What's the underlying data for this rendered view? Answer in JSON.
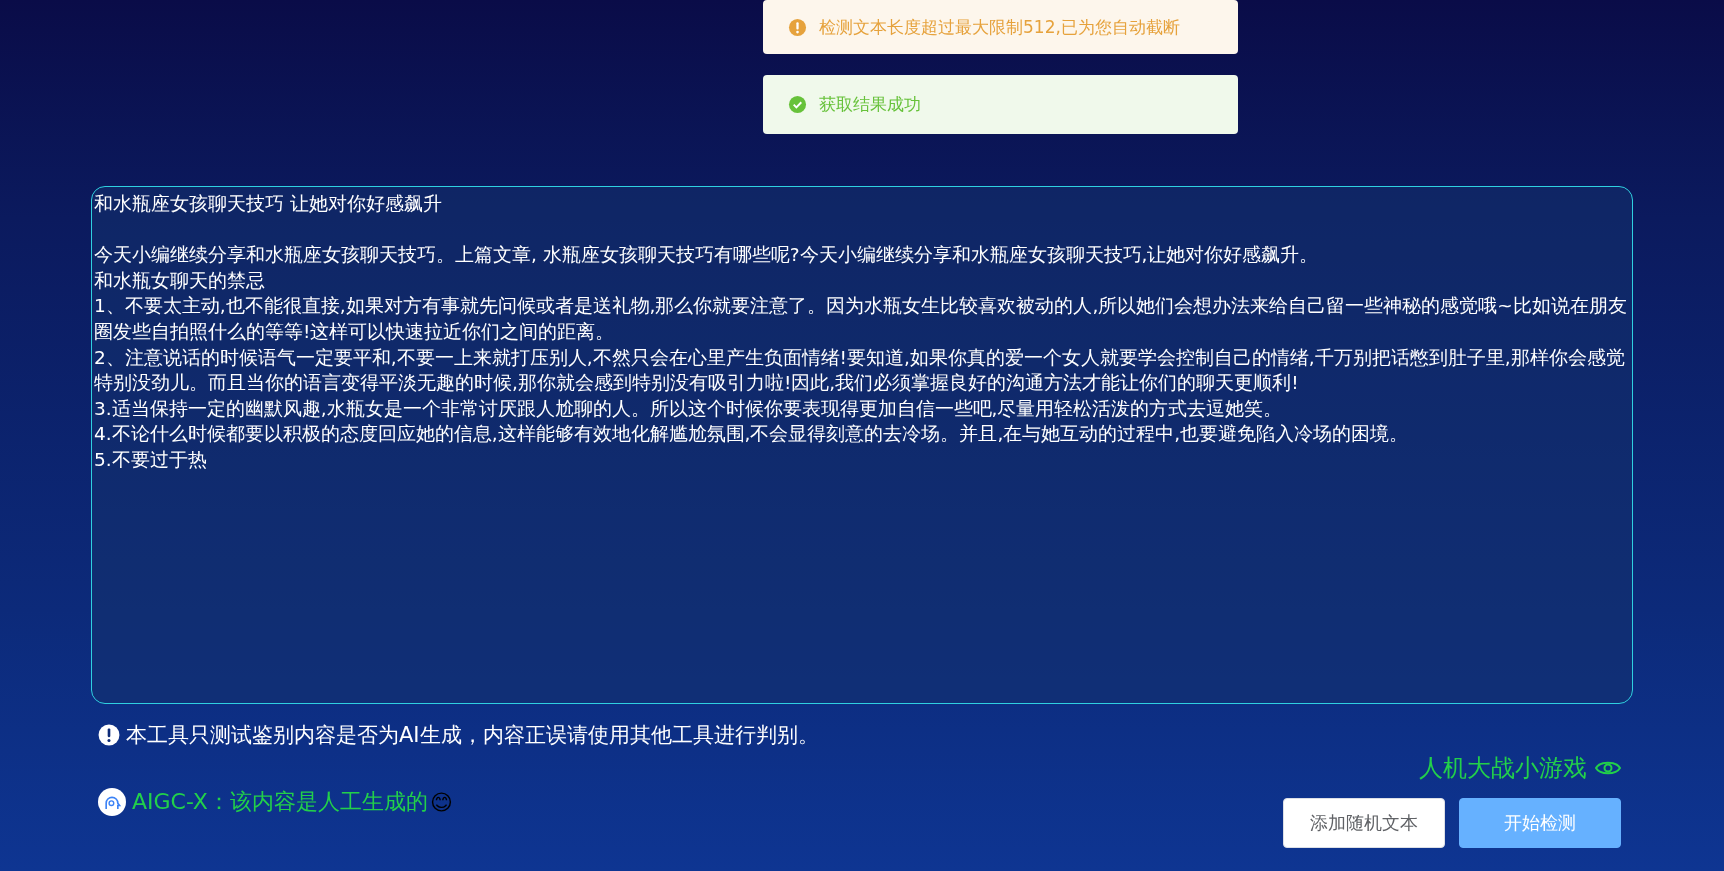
{
  "toasts": [
    {
      "kind": "warning",
      "message": "检测文本长度超过最大限制512,已为您自动截断"
    },
    {
      "kind": "success",
      "message": "获取结果成功"
    }
  ],
  "input": {
    "title": "和水瓶座女孩聊天技巧 让她对你好感飙升",
    "lines": [
      "今天小编继续分享和水瓶座女孩聊天技巧。上篇文章, 水瓶座女孩聊天技巧有哪些呢?今天小编继续分享和水瓶座女孩聊天技巧,让她对你好感飙升。",
      "和水瓶女聊天的禁忌",
      "1、不要太主动,也不能很直接,如果对方有事就先问候或者是送礼物,那么你就要注意了。因为水瓶女生比较喜欢被动的人,所以她们会想办法来给自己留一些神秘的感觉哦~比如说在朋友圈发些自拍照什么的等等!这样可以快速拉近你们之间的距离。",
      "2、注意说话的时候语气一定要平和,不要一上来就打压别人,不然只会在心里产生负面情绪!要知道,如果你真的爱一个女人就要学会控制自己的情绪,千万别把话憋到肚子里,那样你会感觉特别没劲儿。而且当你的语言变得平淡无趣的时候,那你就会感到特别没有吸引力啦!因此,我们必须掌握良好的沟通方法才能让你们的聊天更顺利!",
      "3.适当保持一定的幽默风趣,水瓶女是一个非常讨厌跟人尬聊的人。所以这个时候你要表现得更加自信一些吧,尽量用轻松活泼的方式去逗她笑。",
      "4.不论什么时候都要以积极的态度回应她的信息,这样能够有效地化解尴尬氛围,不会显得刻意的去冷场。并且,在与她互动的过程中,也要避免陷入冷场的困境。",
      "5.不要过于热"
    ]
  },
  "notice": "本工具只测试鉴别内容是否为AI生成，内容正误请使用其他工具进行判别。",
  "game_link": "人机大战小游戏",
  "result": {
    "text": "AIGC-X：该内容是人工生成的",
    "emoji": "😊"
  },
  "buttons": [
    {
      "kind": "secondary",
      "label": "添加随机文本"
    },
    {
      "kind": "primary",
      "label": "开始检测"
    }
  ]
}
